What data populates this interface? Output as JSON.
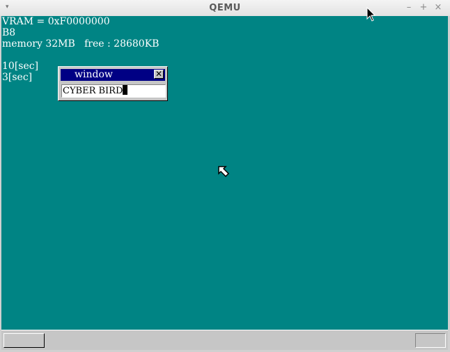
{
  "window": {
    "title": "QEMU",
    "minimize_glyph": "–",
    "maximize_glyph": "+",
    "close_glyph": "×",
    "menu_glyph": "▾"
  },
  "guest": {
    "background_color": "#008484",
    "info_lines": [
      "VRAM = 0xF0000000",
      "B8",
      "memory 32MB   free : 28680KB",
      "",
      "10[sec]",
      "3[sec]"
    ],
    "text_window": {
      "title": "window",
      "close_glyph": "✕",
      "input_value": "CYBER BIRD"
    }
  },
  "taskbar": {
    "start_label": "",
    "tray_label": ""
  },
  "icons": {
    "guest_cursor": "arrow-cursor-icon",
    "host_cursor": "mouse-pointer-icon"
  }
}
